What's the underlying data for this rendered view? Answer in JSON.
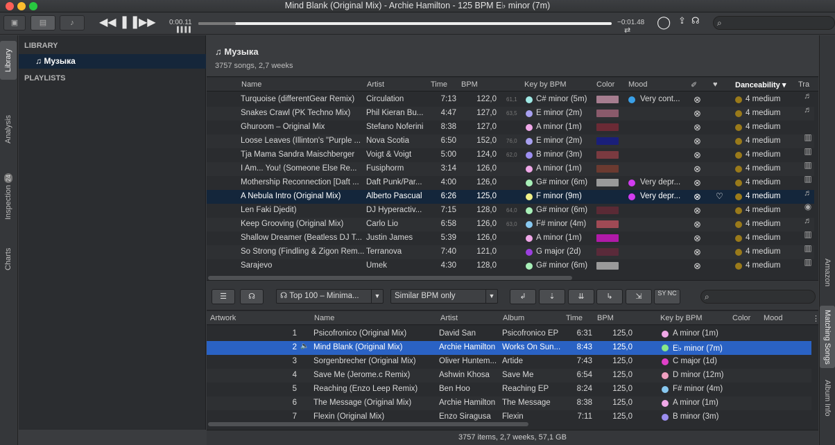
{
  "window": {
    "title": "Mind Blank (Original Mix) - Archie Hamilton - 125 BPM E♭ minor (7m)"
  },
  "player": {
    "elapsed": "0:00.11",
    "remaining": "−0:01.48",
    "progress": 0.09
  },
  "library": {
    "heading": "LIBRARY",
    "item": "Музыка",
    "playlists": "PLAYLISTS"
  },
  "left_tabs": {
    "library": "Library",
    "analysis": "Analysis",
    "inspection": "Inspection",
    "inspection_badge": "24",
    "charts": "Charts"
  },
  "right_tabs": {
    "amazon": "Amazon",
    "matching": "Matching Songs",
    "album": "Album Info"
  },
  "page": {
    "title": "Музыка",
    "subtitle": "3757 songs, 2,7 weeks"
  },
  "colors": {
    "accent": "#2a62c4",
    "selected_row": "#14263b"
  },
  "top_columns": {
    "name": "Name",
    "artist": "Artist",
    "time": "Time",
    "bpm": "BPM",
    "key": "Key by BPM",
    "color": "Color",
    "mood": "Mood",
    "dance": "Danceability ▾",
    "tra": "Tra"
  },
  "songs": [
    {
      "name": "Turquoise (differentGear Remix)",
      "artist": "Circulation",
      "time": "7:13",
      "bpm": "122,0",
      "small": "61,1",
      "kcol": "#9fe8e4",
      "key": "C# minor (5m)",
      "sw": "#a67d8f",
      "mcol": "#3aa0e8",
      "mood": "Very cont...",
      "dance": "4 medium"
    },
    {
      "name": "Snakes Crawl (PK Techno Mix)",
      "artist": "Phil Kieran Bu...",
      "time": "4:47",
      "bpm": "127,0",
      "small": "63,5",
      "kcol": "#a8a0f0",
      "key": "E minor (2m)",
      "sw": "#8a5a6b",
      "mcol": "",
      "mood": "",
      "dance": "4 medium"
    },
    {
      "name": "Ghuroom – Original Mix",
      "artist": "Stefano Noferini",
      "time": "8:38",
      "bpm": "127,0",
      "small": "",
      "kcol": "#f0a8e8",
      "key": "A minor (1m)",
      "sw": "#6b2a35",
      "mcol": "",
      "mood": "",
      "dance": "4 medium"
    },
    {
      "name": "Loose Leaves (Illinton's \"Purple ...",
      "artist": "Nova Scotia",
      "time": "6:50",
      "bpm": "152,0",
      "small": "76,0",
      "kcol": "#a8a0f0",
      "key": "E minor (2m)",
      "sw": "#1a1f7a",
      "mcol": "",
      "mood": "",
      "dance": "4 medium"
    },
    {
      "name": "Tja Mama Sandra Maischberger",
      "artist": "Voigt & Voigt",
      "time": "5:00",
      "bpm": "124,0",
      "small": "62,0",
      "kcol": "#9c8ef0",
      "key": "B minor (3m)",
      "sw": "#7a3a40",
      "mcol": "",
      "mood": "",
      "dance": "4 medium"
    },
    {
      "name": "I Am... You! (Someone Else Re...",
      "artist": "Fusiphorm",
      "time": "3:14",
      "bpm": "126,0",
      "small": "",
      "kcol": "#f0a8e8",
      "key": "A minor (1m)",
      "sw": "#6b3a30",
      "mcol": "",
      "mood": "",
      "dance": "4 medium"
    },
    {
      "name": "Mothership Reconnection [Daft ...",
      "artist": "Daft Punk/Par...",
      "time": "4:00",
      "bpm": "126,0",
      "small": "",
      "kcol": "#a8f0b8",
      "key": "G# minor (6m)",
      "sw": "#9a9a9a",
      "mcol": "#d23cf0",
      "mood": "Very depr...",
      "dance": "4 medium"
    },
    {
      "name": "A Nebula Intro (Original Mix)",
      "artist": "Alberto Pascual",
      "time": "6:26",
      "bpm": "125,0",
      "small": "",
      "kcol": "#f0f088",
      "key": "F minor (9m)",
      "sw": "",
      "mcol": "#d23cf0",
      "mood": "Very depr...",
      "dance": "4 medium"
    },
    {
      "name": "Len Faki Djedit)",
      "artist": "DJ Hyperactiv...",
      "time": "7:15",
      "bpm": "128,0",
      "small": "64,0",
      "kcol": "#a8f0b8",
      "key": "G# minor (6m)",
      "sw": "#5a2a35",
      "mcol": "",
      "mood": "",
      "dance": "4 medium"
    },
    {
      "name": "Keep Grooving (Original Mix)",
      "artist": "Carlo Lio",
      "time": "6:58",
      "bpm": "126,0",
      "small": "63,0",
      "kcol": "#88c8f0",
      "key": "F# minor (4m)",
      "sw": "#a04a55",
      "mcol": "",
      "mood": "",
      "dance": "4 medium"
    },
    {
      "name": "Shallow Dreamer (Beatless DJ T...",
      "artist": "Justin James",
      "time": "5:39",
      "bpm": "126,0",
      "small": "",
      "kcol": "#f0a8e8",
      "key": "A minor (1m)",
      "sw": "#b01aa8",
      "mcol": "",
      "mood": "",
      "dance": "4 medium"
    },
    {
      "name": "So Strong (Findling & Zigon Rem...",
      "artist": "Terranova",
      "time": "7:40",
      "bpm": "121,0",
      "small": "",
      "kcol": "#9c40e0",
      "key": "G major (2d)",
      "sw": "#5a2a3a",
      "mcol": "",
      "mood": "",
      "dance": "4 medium"
    },
    {
      "name": "Sarajevo",
      "artist": "Umek",
      "time": "4:30",
      "bpm": "128,0",
      "small": "",
      "kcol": "#a8f0b8",
      "key": "G# minor (6m)",
      "sw": "#9a9a9a",
      "mcol": "",
      "mood": "",
      "dance": "4 medium"
    }
  ],
  "controls": {
    "playlist": "Top 100 – Minima...",
    "filter": "Similar BPM only",
    "sync": "SY NC"
  },
  "bottom_columns": {
    "artwork": "Artwork",
    "name": "Name",
    "artist": "Artist",
    "album": "Album",
    "time": "Time",
    "bpm": "BPM",
    "key": "Key by BPM",
    "color": "Color",
    "mood": "Mood"
  },
  "matches": [
    {
      "n": "1",
      "name": "Psicofronico (Original Mix)",
      "artist": "David San",
      "album": "Psicofronico EP",
      "time": "6:31",
      "bpm": "125,0",
      "kcol": "#f0a8e8",
      "key": "A minor (1m)"
    },
    {
      "n": "2",
      "name": "Mind Blank (Original Mix)",
      "artist": "Archie Hamilton",
      "album": "Works On Sun...",
      "time": "8:43",
      "bpm": "125,0",
      "kcol": "#88e888",
      "key": "E♭ minor (7m)"
    },
    {
      "n": "3",
      "name": "Sorgenbrecher (Original Mix)",
      "artist": "Oliver Huntem...",
      "album": "Artide",
      "time": "7:43",
      "bpm": "125,0",
      "kcol": "#e040c8",
      "key": "C major (1d)"
    },
    {
      "n": "4",
      "name": "Save Me (Jerome.c Remix)",
      "artist": "Ashwin Khosa",
      "album": "Save Me",
      "time": "6:54",
      "bpm": "125,0",
      "kcol": "#f0a0c0",
      "key": "D minor (12m)"
    },
    {
      "n": "5",
      "name": "Reaching (Enzo Leep Remix)",
      "artist": "Ben Hoo",
      "album": "Reaching EP",
      "time": "8:24",
      "bpm": "125,0",
      "kcol": "#88c8f0",
      "key": "F# minor (4m)"
    },
    {
      "n": "6",
      "name": "The Message (Original Mix)",
      "artist": "Archie Hamilton",
      "album": "The Message",
      "time": "8:38",
      "bpm": "125,0",
      "kcol": "#f0a8e8",
      "key": "A minor (1m)"
    },
    {
      "n": "7",
      "name": "Flexin (Original Mix)",
      "artist": "Enzo Siragusa",
      "album": "Flexin",
      "time": "7:11",
      "bpm": "125,0",
      "kcol": "#9c8ef0",
      "key": "B minor (3m)"
    }
  ],
  "status": "3757 items, 2,7 weeks, 57,1 GB"
}
